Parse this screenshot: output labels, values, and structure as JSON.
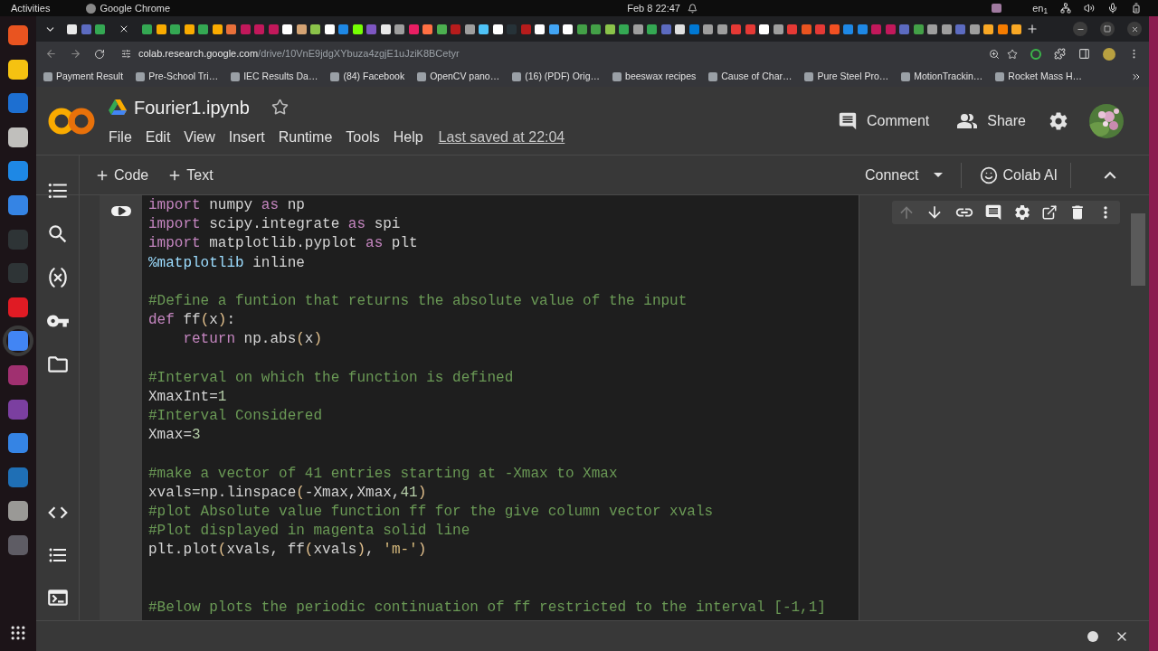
{
  "os_bar": {
    "activities": "Activities",
    "app": "Google Chrome",
    "clock": "Feb 8  22:47",
    "language": "en$_{1}$"
  },
  "browser": {
    "url_host": "colab.research.google.com",
    "url_path": "/drive/10VnE9jdgXYbuza4zgjE1uJziK8BCetyr",
    "bookmarks": [
      "Payment Result",
      "Pre-School Tri…",
      "IEC Results Da…",
      "(84) Facebook",
      "OpenCV pano…",
      "(16) (PDF) Orig…",
      "beeswax recipes",
      "Cause of Char…",
      "Pure Steel Pro…",
      "MotionTrackin…",
      "Rocket Mass H…"
    ]
  },
  "notebook": {
    "title": "Fourier1.ipynb",
    "menu": [
      "File",
      "Edit",
      "View",
      "Insert",
      "Runtime",
      "Tools",
      "Help"
    ],
    "last_saved": "Last saved at 22:04",
    "comment": "Comment",
    "share": "Share",
    "toolbar": {
      "add_code": "Code",
      "add_text": "Text",
      "connect": "Connect",
      "colab_ai": "Colab AI"
    },
    "code": [
      {
        "kind": "code",
        "tokens": [
          {
            "kind": "keyword",
            "text": "import"
          },
          {
            "kind": "name",
            "text": " numpy "
          },
          {
            "kind": "keyword",
            "text": "as"
          },
          {
            "kind": "name",
            "text": " np"
          }
        ]
      },
      {
        "kind": "code",
        "tokens": [
          {
            "kind": "keyword",
            "text": "import"
          },
          {
            "kind": "name",
            "text": " scipy.integrate "
          },
          {
            "kind": "keyword",
            "text": "as"
          },
          {
            "kind": "name",
            "text": " spi"
          }
        ]
      },
      {
        "kind": "code",
        "tokens": [
          {
            "kind": "keyword",
            "text": "import"
          },
          {
            "kind": "name",
            "text": " matplotlib.pyplot "
          },
          {
            "kind": "keyword",
            "text": "as"
          },
          {
            "kind": "name",
            "text": " plt"
          }
        ]
      },
      {
        "kind": "code",
        "tokens": [
          {
            "kind": "magic",
            "text": "%matplotlib"
          },
          {
            "kind": "name",
            "text": " inline"
          }
        ]
      },
      {
        "kind": "blank"
      },
      {
        "kind": "code",
        "tokens": [
          {
            "kind": "comment",
            "text": "#Define a funtion that returns the absolute value of the input"
          }
        ]
      },
      {
        "kind": "code",
        "tokens": [
          {
            "kind": "keyword",
            "text": "def"
          },
          {
            "kind": "name",
            "text": " ff"
          },
          {
            "kind": "bracket",
            "text": "("
          },
          {
            "kind": "name",
            "text": "x"
          },
          {
            "kind": "bracket",
            "text": ")"
          },
          {
            "kind": "name",
            "text": ":"
          }
        ]
      },
      {
        "kind": "code",
        "tokens": [
          {
            "kind": "keyword",
            "text": "    return"
          },
          {
            "kind": "name",
            "text": " np.abs"
          },
          {
            "kind": "bracket",
            "text": "("
          },
          {
            "kind": "name",
            "text": "x"
          },
          {
            "kind": "bracket",
            "text": ")"
          }
        ]
      },
      {
        "kind": "blank"
      },
      {
        "kind": "code",
        "tokens": [
          {
            "kind": "comment",
            "text": "#Interval on which the function is defined"
          }
        ]
      },
      {
        "kind": "code",
        "tokens": [
          {
            "kind": "name",
            "text": "XmaxInt="
          },
          {
            "kind": "number",
            "text": "1"
          }
        ]
      },
      {
        "kind": "code",
        "tokens": [
          {
            "kind": "comment",
            "text": "#Interval Considered"
          }
        ]
      },
      {
        "kind": "code",
        "tokens": [
          {
            "kind": "name",
            "text": "Xmax="
          },
          {
            "kind": "number",
            "text": "3"
          }
        ]
      },
      {
        "kind": "blank"
      },
      {
        "kind": "code",
        "tokens": [
          {
            "kind": "comment",
            "text": "#make a vector of 41 entries starting at -Xmax to Xmax"
          }
        ]
      },
      {
        "kind": "code",
        "tokens": [
          {
            "kind": "name",
            "text": "xvals=np.linspace"
          },
          {
            "kind": "bracket",
            "text": "("
          },
          {
            "kind": "name",
            "text": "-Xmax,Xmax,"
          },
          {
            "kind": "number",
            "text": "41"
          },
          {
            "kind": "bracket",
            "text": ")"
          }
        ]
      },
      {
        "kind": "code",
        "tokens": [
          {
            "kind": "comment",
            "text": "#plot Absolute value function ff for the give column vector xvals"
          }
        ]
      },
      {
        "kind": "code",
        "tokens": [
          {
            "kind": "comment",
            "text": "#Plot displayed in magenta solid line"
          }
        ]
      },
      {
        "kind": "code",
        "tokens": [
          {
            "kind": "name",
            "text": "plt.plot"
          },
          {
            "kind": "bracket",
            "text": "("
          },
          {
            "kind": "name",
            "text": "xvals, ff"
          },
          {
            "kind": "bracket",
            "text": "("
          },
          {
            "kind": "name",
            "text": "xvals"
          },
          {
            "kind": "bracket",
            "text": ")"
          },
          {
            "kind": "name",
            "text": ", "
          },
          {
            "kind": "string",
            "text": "'m-'"
          },
          {
            "kind": "bracket",
            "text": ")"
          }
        ]
      },
      {
        "kind": "blank"
      },
      {
        "kind": "blank"
      },
      {
        "kind": "code",
        "tokens": [
          {
            "kind": "comment",
            "text": "#Below plots the periodic continuation of ff restricted to the interval [-1,1]"
          }
        ]
      }
    ]
  }
}
